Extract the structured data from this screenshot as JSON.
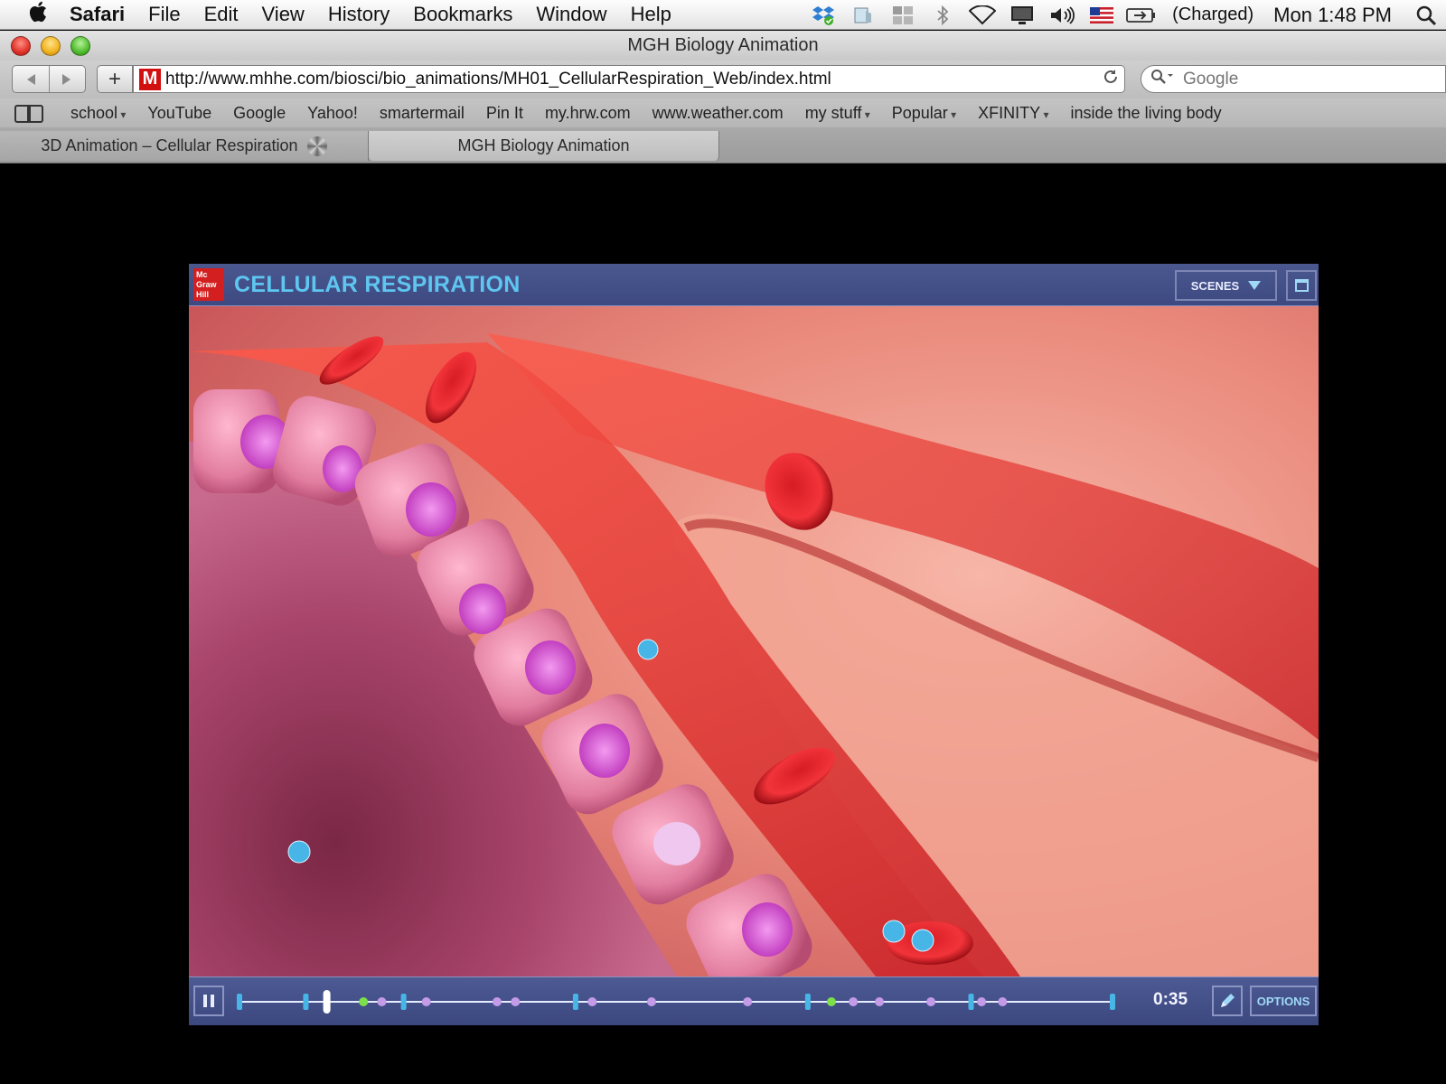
{
  "menubar": {
    "app_name": "Safari",
    "items": [
      "File",
      "Edit",
      "View",
      "History",
      "Bookmarks",
      "Window",
      "Help"
    ],
    "status_icons": [
      "dropbox-icon",
      "scanner-icon",
      "spaces-icon",
      "bluetooth-icon",
      "wifi-icon",
      "display-icon",
      "volume-icon",
      "us-flag-icon",
      "battery-icon"
    ],
    "battery_text": "(Charged)",
    "clock": "Mon 1:48 PM"
  },
  "window": {
    "title": "MGH Biology Animation"
  },
  "toolbar": {
    "url": "http://www.mhhe.com/biosci/bio_animations/MH01_CellularRespiration_Web/index.html",
    "favicon_letter": "M",
    "search_placeholder": "Google"
  },
  "bookmarks": [
    {
      "label": "school",
      "menu": true
    },
    {
      "label": "YouTube",
      "menu": false
    },
    {
      "label": "Google",
      "menu": false
    },
    {
      "label": "Yahoo!",
      "menu": false
    },
    {
      "label": "smartermail",
      "menu": false
    },
    {
      "label": "Pin It",
      "menu": false
    },
    {
      "label": "my.hrw.com",
      "menu": false
    },
    {
      "label": "www.weather.com",
      "menu": false
    },
    {
      "label": "my stuff",
      "menu": true
    },
    {
      "label": "Popular",
      "menu": true
    },
    {
      "label": "XFINITY",
      "menu": true
    },
    {
      "label": "inside the living body",
      "menu": false
    }
  ],
  "tabs": [
    {
      "label": "3D Animation – Cellular Respiration",
      "loading": true,
      "active": false
    },
    {
      "label": "MGH Biology Animation",
      "loading": false,
      "active": true
    }
  ],
  "player": {
    "logo_text": "Mc Graw Hill",
    "title": "CELLULAR RESPIRATION",
    "scenes_label": "SCENES",
    "time": "0:35",
    "options_label": "OPTIONS",
    "playback_progress": 0.1,
    "colors": {
      "header": "#4b5890",
      "title": "#5ec6f0",
      "accent": "#47b6e6",
      "marker_purple": "#c39be8",
      "marker_green": "#7be04a"
    },
    "timeline_markers": [
      {
        "pos": 0.0,
        "kind": "bar"
      },
      {
        "pos": 0.076,
        "kind": "bar"
      },
      {
        "pos": 0.142,
        "kind": "dot-green"
      },
      {
        "pos": 0.163,
        "kind": "dot"
      },
      {
        "pos": 0.188,
        "kind": "bar"
      },
      {
        "pos": 0.214,
        "kind": "dot"
      },
      {
        "pos": 0.295,
        "kind": "dot"
      },
      {
        "pos": 0.316,
        "kind": "dot"
      },
      {
        "pos": 0.385,
        "kind": "bar"
      },
      {
        "pos": 0.404,
        "kind": "dot"
      },
      {
        "pos": 0.472,
        "kind": "dot"
      },
      {
        "pos": 0.582,
        "kind": "dot"
      },
      {
        "pos": 0.651,
        "kind": "bar"
      },
      {
        "pos": 0.678,
        "kind": "dot-green"
      },
      {
        "pos": 0.703,
        "kind": "dot"
      },
      {
        "pos": 0.733,
        "kind": "dot"
      },
      {
        "pos": 0.792,
        "kind": "dot"
      },
      {
        "pos": 0.838,
        "kind": "bar"
      },
      {
        "pos": 0.85,
        "kind": "dot"
      },
      {
        "pos": 0.874,
        "kind": "dot"
      },
      {
        "pos": 1.0,
        "kind": "bar"
      }
    ]
  }
}
